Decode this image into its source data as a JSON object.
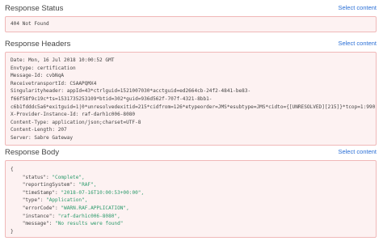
{
  "status_section": {
    "title": "Response Status",
    "select_label": "Select content",
    "value": "404 Not Found"
  },
  "headers_section": {
    "title": "Response Headers",
    "select_label": "Select content",
    "lines": [
      "Date: Mon, 16 Jul 2018 10:00:52 GMT",
      "Envtype: certification",
      "Message-Id: cvbNqA",
      "ReceivetransportId: CSAAPQMX4",
      "Singularityheader: appId=43*ctrlguid=1521007030*acctguid=ed2664cb-24f2-4841-be83-",
      "f66f58f9c19c*ts=1531735253109*btid=302*guid=936d562f-707f-4321-8bb1-",
      "c6b1fdddc5a6*exitguid=1|0*unresolvedexitid=215*cidfrom=126*etypeorder=JMS*esubtype=JMS*cidto={[UNRESOLVED][215]}*tcop=1:990",
      "X-Provider-Instance-Id: raf-darh1c006-8080",
      "Content-Type: application/json;charset=UTF-8",
      "Content-Length: 207",
      "Server: Sabre Gateway"
    ]
  },
  "body_section": {
    "title": "Response Body",
    "select_label": "Select content",
    "open_brace": "{",
    "close_brace": "}",
    "fields": [
      {
        "key": "\"status\": ",
        "value": "\"Complete\","
      },
      {
        "key": "\"reportingSystem\": ",
        "value": "\"RAF\","
      },
      {
        "key": "\"timeStamp\": ",
        "value": "\"2018-07-16T10:00:53+00:00\","
      },
      {
        "key": "\"type\": ",
        "value": "\"Application\","
      },
      {
        "key": "\"errorCode\": ",
        "value": "\"WARN.RAF.APPLICATION\","
      },
      {
        "key": "\"instance\": ",
        "value": "\"raf-darh1c006-8080\","
      },
      {
        "key": "\"message\": ",
        "value": "\"No results were found\""
      }
    ]
  },
  "colors": {
    "box_bg": "#fdf2f2",
    "box_border": "#f0b8b8",
    "link": "#2a6fd6",
    "json_value": "#2b9a6b"
  }
}
